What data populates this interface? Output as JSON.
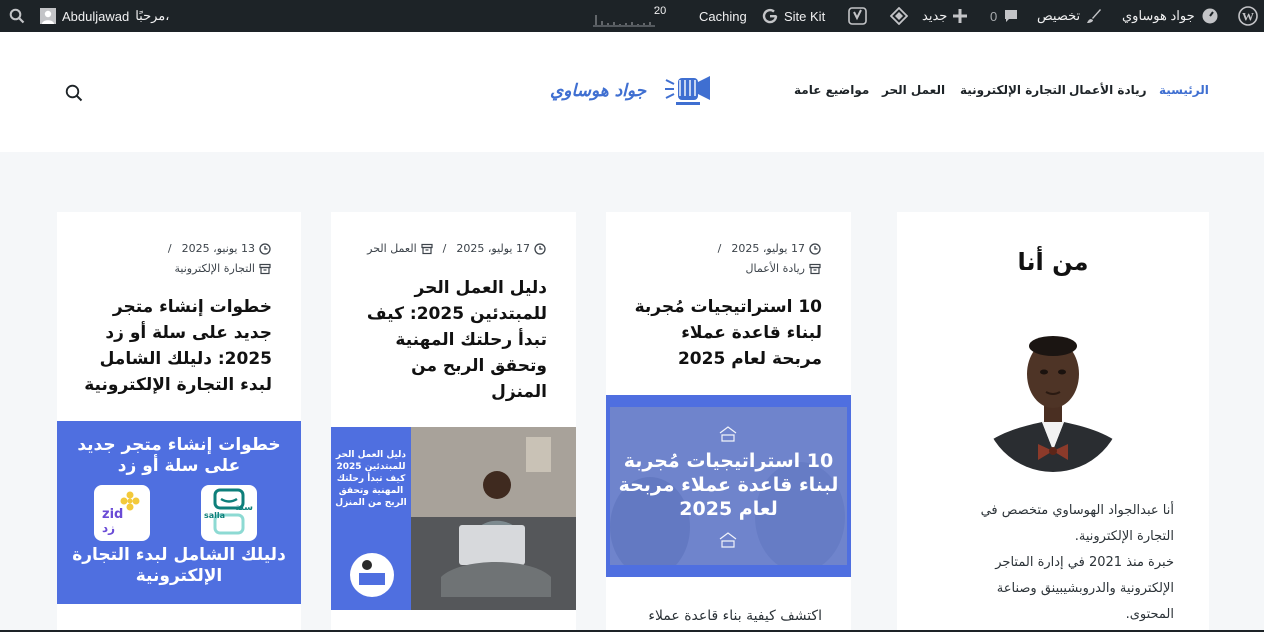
{
  "admin_bar": {
    "site_name": "جواد هوساوي",
    "customize": "تخصيص",
    "comments_count": "0",
    "new_label": "جديد",
    "site_kit": "Site Kit",
    "caching": "Caching",
    "stats_count": "20",
    "greeting": "مرحبًا،",
    "username": "Abduljawad"
  },
  "header": {
    "logo_text": "جواد هوساوي",
    "nav": [
      {
        "label": "الرئيسية",
        "active": true
      },
      {
        "label": "ريادة الأعمال",
        "active": false
      },
      {
        "label": "التجارة الإلكترونية",
        "active": false
      },
      {
        "label": "العمل الحر",
        "active": false
      },
      {
        "label": "مواضيع عامة",
        "active": false
      }
    ]
  },
  "about": {
    "heading": "من أنا",
    "lines": [
      "أنا عبدالجواد الهوساوي متخصص في",
      "التجارة الإلكترونية.",
      "خبرة منذ 2021 في إدارة المتاجر",
      "الإلكترونية والدروبشيبينق وصناعة",
      "المحتوى."
    ]
  },
  "posts": [
    {
      "date": "17 يوليو، 2025",
      "category": "ريادة الأعمال",
      "title": "10 استراتيجيات مُجربة لبناء قاعدة عملاء مربحة لعام 2025",
      "thumb_text": "10 استراتيجيات مُجربة لبناء قاعدة عملاء مربحة لعام 2025",
      "excerpt": "اكتشف كيفية بناء قاعدة عملاء"
    },
    {
      "date": "17 يوليو، 2025",
      "category": "العمل الحر",
      "title": "دليل العمل الحر للمبتدئين 2025: كيف تبدأ رحلتك المهنية وتحقق الربح من المنزل",
      "thumb_text": "دليل العمل الحر للمبتدئين 2025 كيف تبدأ رحلتك المهنية وتحقق الربح من المنزل"
    },
    {
      "date": "13 يونيو، 2025",
      "category": "التجارة الإلكترونية",
      "title": "خطوات إنشاء متجر جديد على سلة أو زد 2025: دليلك الشامل لبدء التجارة الإلكترونية",
      "thumb_top": "خطوات إنشاء متجر جديد على سلة أو زد",
      "thumb_bottom": "دليلك الشامل لبدء التجارة الإلكترونية",
      "salla_ar": "سلة",
      "salla_en": "salla",
      "zid_en": "zid",
      "zid_ar": "زد"
    }
  ],
  "colors": {
    "accent": "#3f6fd1",
    "admin_bar": "#1d2327",
    "thumb_blue": "#4f6fe0"
  }
}
